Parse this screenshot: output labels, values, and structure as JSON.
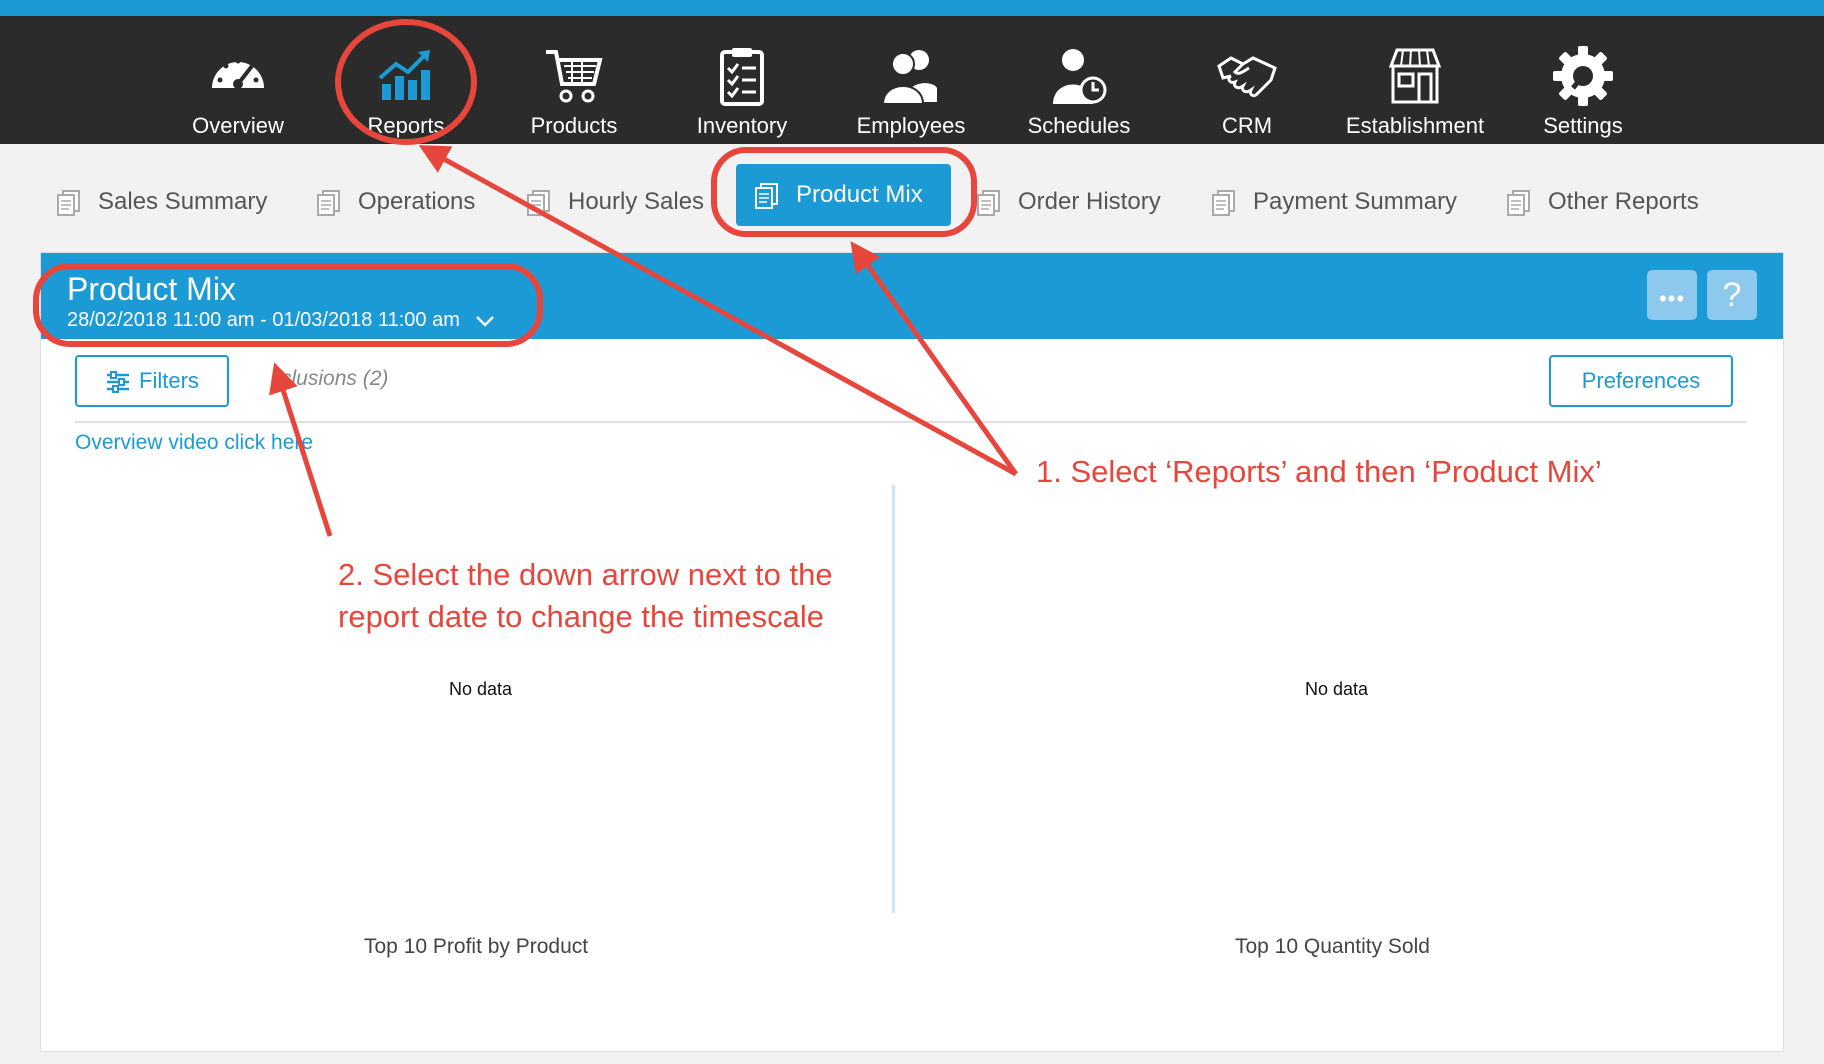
{
  "nav": {
    "items": [
      {
        "label": "Overview",
        "icon": "speedometer-icon"
      },
      {
        "label": "Reports",
        "icon": "chart-icon"
      },
      {
        "label": "Products",
        "icon": "cart-icon"
      },
      {
        "label": "Inventory",
        "icon": "clipboard-icon"
      },
      {
        "label": "Employees",
        "icon": "people-icon"
      },
      {
        "label": "Schedules",
        "icon": "person-clock-icon"
      },
      {
        "label": "CRM",
        "icon": "handshake-icon"
      },
      {
        "label": "Establishment",
        "icon": "store-icon"
      },
      {
        "label": "Settings",
        "icon": "gear-icon"
      }
    ]
  },
  "tabs": [
    {
      "label": "Sales Summary"
    },
    {
      "label": "Operations"
    },
    {
      "label": "Hourly Sales"
    },
    {
      "label": "Product Mix"
    },
    {
      "label": "Order History"
    },
    {
      "label": "Payment Summary"
    },
    {
      "label": "Other Reports"
    }
  ],
  "report": {
    "title": "Product Mix",
    "date_range": "28/02/2018 11:00 am - 01/03/2018 11:00 am",
    "more_glyph": "•••",
    "help_glyph": "?",
    "filters_label": "Filters",
    "exclusions_label": "clusions (2)",
    "preferences_label": "Preferences",
    "overview_link": "Overview video click here",
    "charts": [
      {
        "no_data": "No data",
        "caption": "Top 10 Profit by Product"
      },
      {
        "no_data": "No data",
        "caption": "Top 10 Quantity Sold"
      }
    ]
  },
  "annotations": {
    "step1": "1. Select ‘Reports’ and then ‘Product Mix’",
    "step2_line1": "2. Select the down arrow next to the",
    "step2_line2": "report date to change the timescale"
  },
  "colors": {
    "accent": "#1c9ad6",
    "navbar": "#2b2b2b",
    "annotation": "#e6463c"
  }
}
